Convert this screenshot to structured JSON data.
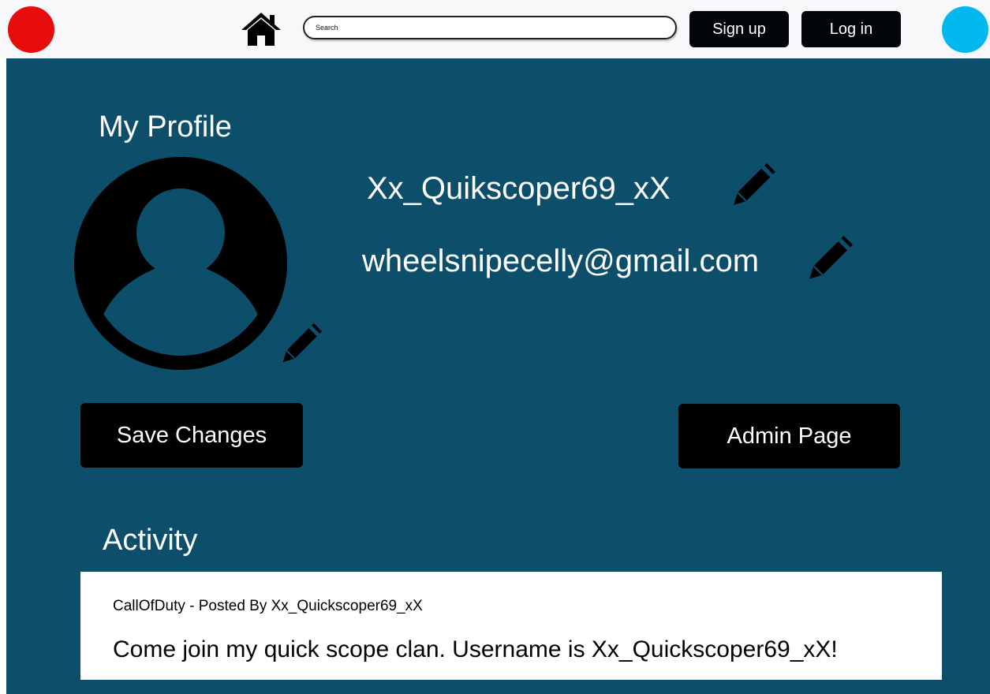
{
  "header": {
    "search_placeholder": "Search",
    "signup_label": "Sign up",
    "login_label": "Log in"
  },
  "profile": {
    "title": "My Profile",
    "username": "Xx_Quikscoper69_xX",
    "email": "wheelsnipecelly@gmail.com"
  },
  "actions": {
    "save_label": "Save Changes",
    "admin_label": "Admin Page"
  },
  "activity": {
    "title": "Activity",
    "posts": [
      {
        "meta": "CallOfDuty - Posted By Xx_Quickscoper69_xX",
        "body": "Come join my quick scope clan. Username is Xx_Quickscoper69_xX!"
      }
    ]
  },
  "colors": {
    "main_background": "#0d4f6b",
    "logo_left": "#e80c0c",
    "logo_right": "#02b8ef",
    "button": "#000000"
  },
  "icons": [
    "home-icon",
    "avatar-icon",
    "pencil-icon"
  ]
}
